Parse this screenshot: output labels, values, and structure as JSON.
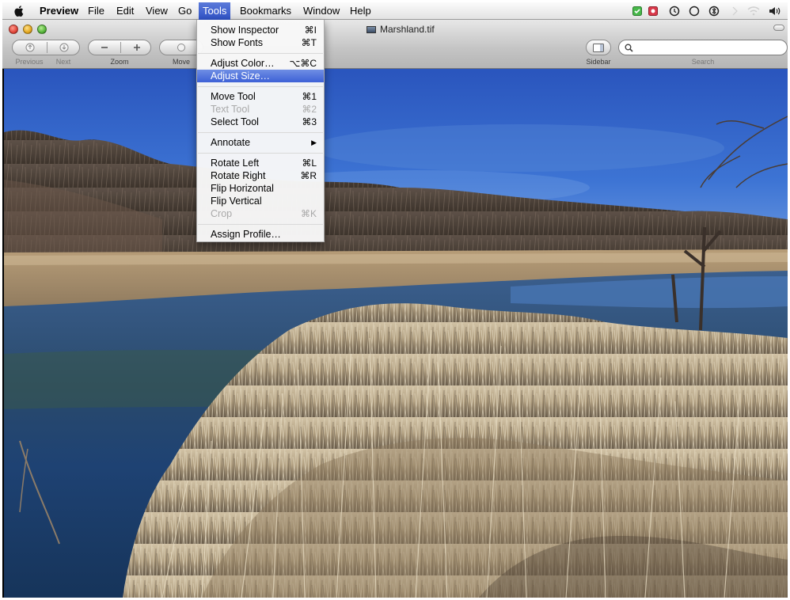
{
  "menubar": {
    "app_name": "Preview",
    "items": [
      "File",
      "Edit",
      "View",
      "Go",
      "Tools",
      "Bookmarks",
      "Window",
      "Help"
    ],
    "active_item": "Tools",
    "tray_icons": [
      "growl-icon",
      "record-icon",
      "time-machine-icon",
      "sync-icon",
      "bluetooth-icon",
      "wifi-icon",
      "volume-icon"
    ]
  },
  "window": {
    "title": "Marshland.tif",
    "toolbar": {
      "previous_label": "Previous",
      "next_label": "Next",
      "zoom_label": "Zoom",
      "move_label": "Move",
      "sidebar_label": "Sidebar",
      "search_label": "Search",
      "search_value": ""
    }
  },
  "tools_menu": {
    "items": [
      {
        "label": "Show Inspector",
        "shortcut": "⌘I",
        "enabled": true
      },
      {
        "label": "Show Fonts",
        "shortcut": "⌘T",
        "enabled": true
      },
      {
        "label": "Adjust Color…",
        "shortcut": "⌥⌘C",
        "enabled": true
      },
      {
        "label": "Adjust Size…",
        "shortcut": "",
        "enabled": true,
        "highlighted": true
      },
      {
        "label": "Move Tool",
        "shortcut": "⌘1",
        "enabled": true
      },
      {
        "label": "Text Tool",
        "shortcut": "⌘2",
        "enabled": false
      },
      {
        "label": "Select Tool",
        "shortcut": "⌘3",
        "enabled": true
      },
      {
        "label": "Annotate",
        "shortcut": "▶",
        "enabled": true
      },
      {
        "label": "Rotate Left",
        "shortcut": "⌘L",
        "enabled": true
      },
      {
        "label": "Rotate Right",
        "shortcut": "⌘R",
        "enabled": true
      },
      {
        "label": "Flip Horizontal",
        "shortcut": "",
        "enabled": true
      },
      {
        "label": "Flip Vertical",
        "shortcut": "",
        "enabled": true
      },
      {
        "label": "Crop",
        "shortcut": "⌘K",
        "enabled": false
      },
      {
        "label": "Assign Profile…",
        "shortcut": "",
        "enabled": true
      }
    ]
  },
  "colors": {
    "menu_highlight": "#3d61d6",
    "sky": "#2f63c8",
    "water": "#1e3f6e",
    "reeds": "#b9a789"
  }
}
